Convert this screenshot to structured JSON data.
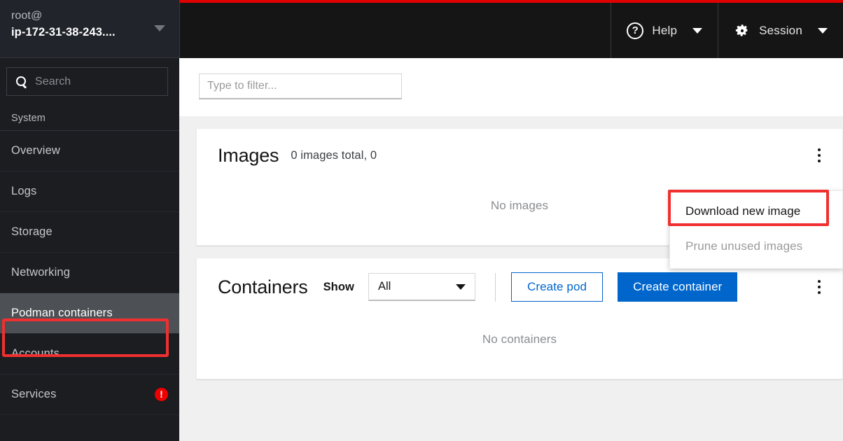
{
  "sidebar": {
    "user": {
      "line1": "root@",
      "line2": "ip-172-31-38-243....",
      "caret_icon": "caret-down-icon"
    },
    "search": {
      "placeholder": "Search",
      "value": "",
      "icon": "search-icon"
    },
    "section_label": "System",
    "items": [
      {
        "label": "Overview",
        "selected": false,
        "badge": ""
      },
      {
        "label": "Logs",
        "selected": false,
        "badge": ""
      },
      {
        "label": "Storage",
        "selected": false,
        "badge": ""
      },
      {
        "label": "Networking",
        "selected": false,
        "badge": ""
      },
      {
        "label": "Podman containers",
        "selected": true,
        "badge": ""
      },
      {
        "label": "Accounts",
        "selected": false,
        "badge": ""
      },
      {
        "label": "Services",
        "selected": false,
        "badge": "!"
      }
    ]
  },
  "topbar": {
    "accent_color": "#e00000",
    "help": {
      "label": "Help",
      "icon": "question-circle-icon",
      "caret_icon": "caret-down-icon"
    },
    "session": {
      "label": "Session",
      "icon": "gear-icon",
      "caret_icon": "caret-down-icon"
    }
  },
  "filter": {
    "placeholder": "Type to filter...",
    "value": ""
  },
  "images_card": {
    "title": "Images",
    "subtitle": "0 images total, 0",
    "empty_text": "No images",
    "kebab_icon": "kebab-menu-icon"
  },
  "images_menu": {
    "items": [
      {
        "label": "Download new image",
        "disabled": false
      },
      {
        "label": "Prune unused images",
        "disabled": true
      }
    ],
    "highlight_color": "#f03030"
  },
  "containers_card": {
    "title": "Containers",
    "show_label": "Show",
    "filter_value": "All",
    "filter_caret_icon": "caret-down-icon",
    "create_pod_label": "Create pod",
    "create_container_label": "Create container",
    "empty_text": "No containers",
    "kebab_icon": "kebab-menu-icon",
    "primary_color": "#0066cc"
  }
}
